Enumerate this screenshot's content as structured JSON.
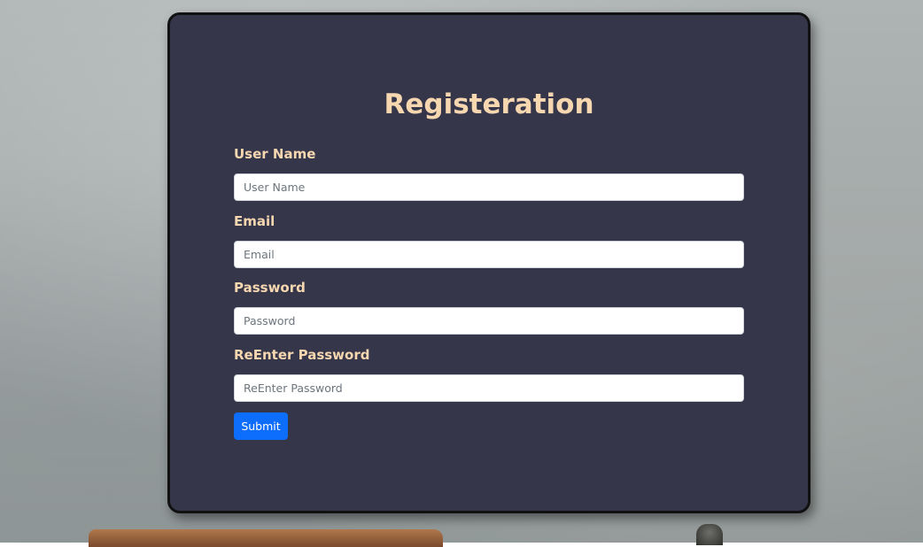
{
  "form": {
    "title": "Registeration",
    "fields": [
      {
        "label": "User Name",
        "placeholder": "User Name",
        "value": ""
      },
      {
        "label": "Email",
        "placeholder": "Email",
        "value": ""
      },
      {
        "label": "Password",
        "placeholder": "Password",
        "value": ""
      },
      {
        "label": "ReEnter Password",
        "placeholder": "ReEnter Password",
        "value": ""
      }
    ],
    "submit_label": "Submit"
  },
  "colors": {
    "card_background": "#36364b",
    "label_text": "#f6d7b0",
    "submit_button": "#0d6efd"
  }
}
